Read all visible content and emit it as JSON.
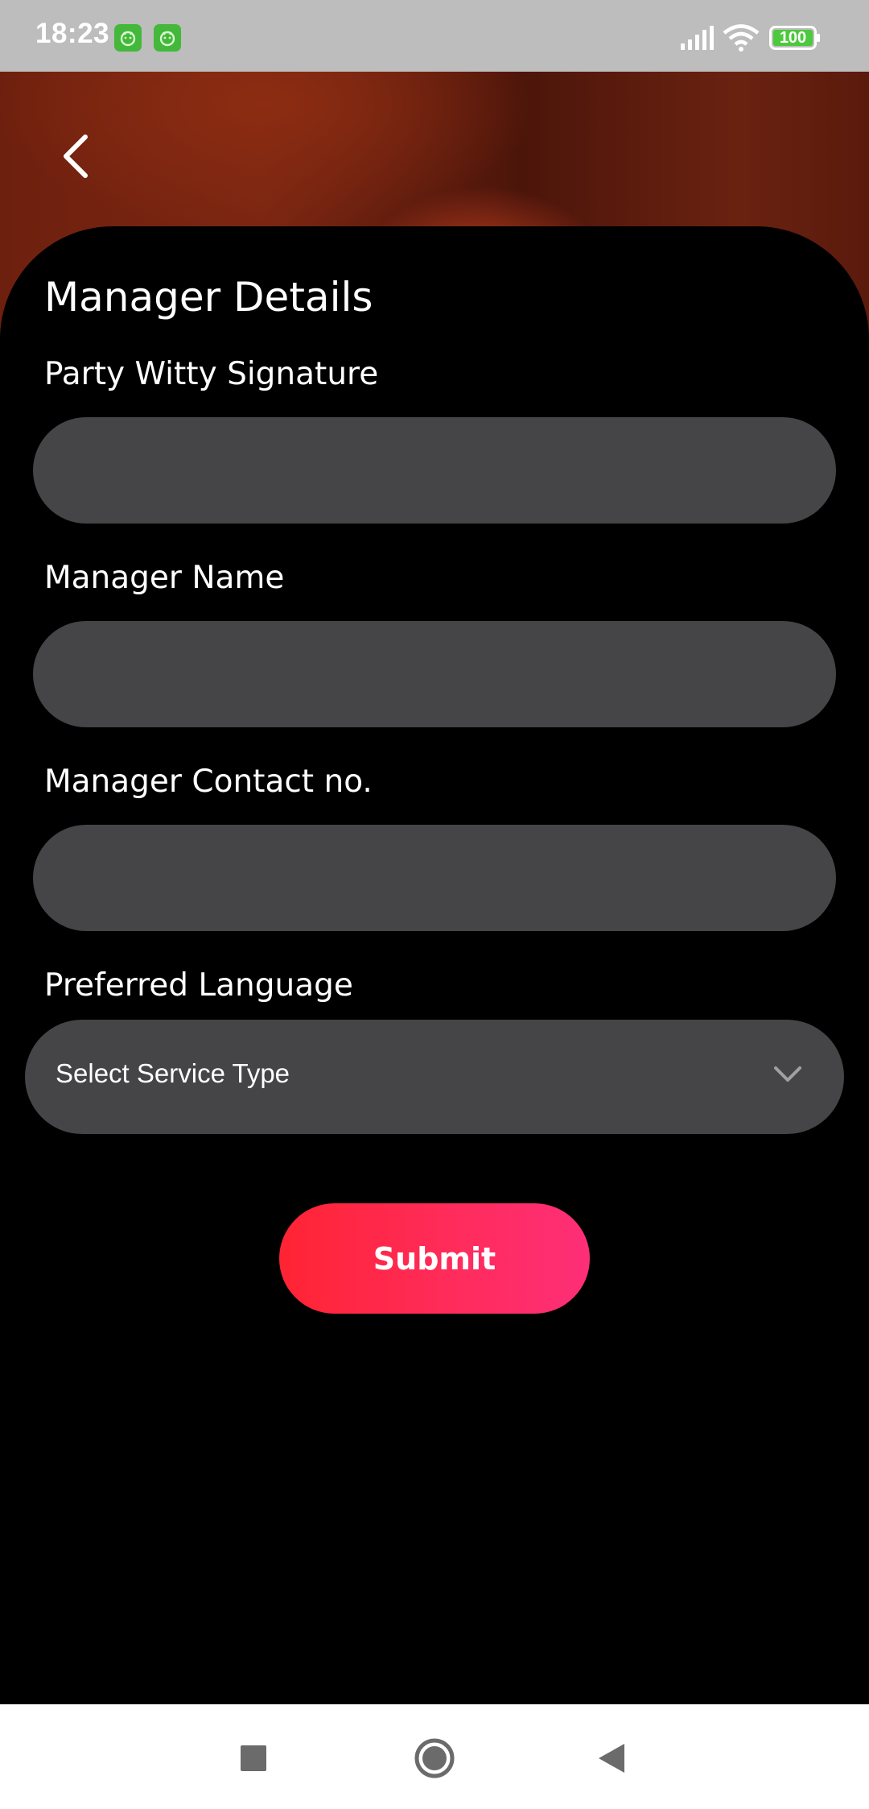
{
  "status_bar": {
    "time": "18:23",
    "battery": "100",
    "icons": [
      "app-notification-icon",
      "app-notification-icon",
      "signal-icon",
      "wifi-icon",
      "battery-icon"
    ]
  },
  "header": {
    "back_icon": "chevron-left-icon"
  },
  "form": {
    "title": "Manager Details",
    "fields": [
      {
        "label": "Party Witty Signature",
        "value": "",
        "placeholder": ""
      },
      {
        "label": "Manager Name",
        "value": "",
        "placeholder": ""
      },
      {
        "label": "Manager Contact no.",
        "value": "",
        "placeholder": ""
      }
    ],
    "language": {
      "label": "Preferred Language",
      "selected": "Select Service Type",
      "icon": "chevron-down-icon"
    },
    "submit_label": "Submit"
  },
  "nav_bar": {
    "icons": [
      "recents-square-icon",
      "home-circle-icon",
      "back-triangle-icon"
    ]
  },
  "colors": {
    "background": "#000000",
    "field": "#454547",
    "accent_start": "#ff2433",
    "accent_end": "#fe2e78",
    "status_bar": "#bdbdbd"
  }
}
